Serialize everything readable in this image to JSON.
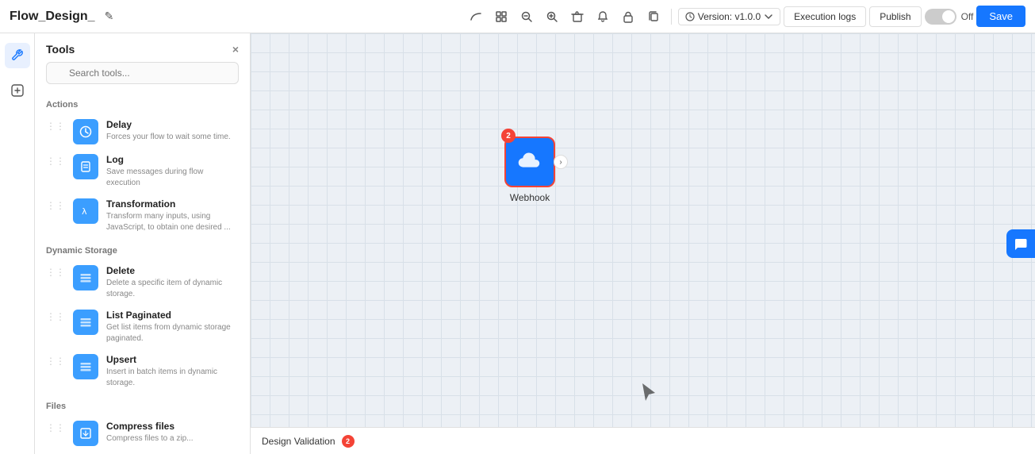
{
  "header": {
    "title": "Flow_Design_",
    "edit_icon": "✎",
    "toolbar": {
      "curve_icon": "〜",
      "grid_icon": "⊞",
      "zoom_out_icon": "−",
      "zoom_in_icon": "+",
      "delete_icon": "🗑",
      "bell_icon": "🔔",
      "lock_icon": "🔒",
      "copy_icon": "📋"
    },
    "version_label": "Version: v1.0.0",
    "execution_logs_label": "Execution logs",
    "publish_label": "Publish",
    "toggle_label": "Off",
    "save_label": "Save"
  },
  "sidebar": {
    "icons": [
      {
        "name": "tools-icon",
        "symbol": "⚙",
        "active": true
      },
      {
        "name": "add-icon",
        "symbol": "+",
        "active": false
      }
    ]
  },
  "tools_panel": {
    "title": "Tools",
    "search_placeholder": "Search tools...",
    "close_icon": "×",
    "sections": [
      {
        "title": "Actions",
        "items": [
          {
            "name": "Delay",
            "desc": "Forces your flow to wait some time.",
            "icon": "⏰"
          },
          {
            "name": "Log",
            "desc": "Save messages during flow execution",
            "icon": "📝"
          },
          {
            "name": "Transformation",
            "desc": "Transform many inputs, using JavaScript, to obtain one desired ...",
            "icon": "λ"
          }
        ]
      },
      {
        "title": "Dynamic Storage",
        "items": [
          {
            "name": "Delete",
            "desc": "Delete a specific item of dynamic storage.",
            "icon": "🗄"
          },
          {
            "name": "List Paginated",
            "desc": "Get list items from dynamic storage paginated.",
            "icon": "🗄"
          },
          {
            "name": "Upsert",
            "desc": "Insert in batch items in dynamic storage.",
            "icon": "🗄"
          }
        ]
      },
      {
        "title": "Files",
        "items": [
          {
            "name": "Compress files",
            "desc": "Compress files to a zip...",
            "icon": "📁"
          }
        ]
      }
    ]
  },
  "canvas": {
    "webhook_node": {
      "label": "Webhook",
      "badge": "2",
      "arrow": "›"
    }
  },
  "bottom_bar": {
    "label": "Design Validation",
    "badge": "2"
  },
  "chat_btn": {
    "icon": "💬"
  }
}
